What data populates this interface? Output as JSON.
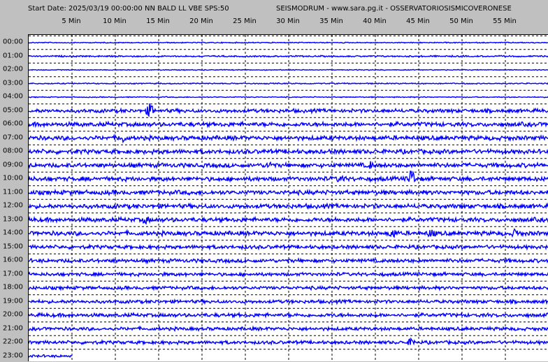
{
  "header": {
    "left": "Start Date: 2025/03/19 00:00:00 NN BALD LL VBE SPS:50",
    "right": "SEISMODRUM - www.sara.pg.it - OSSERVATORIOSISMICOVERONESE"
  },
  "colors": {
    "trace": "#0000ff",
    "background_window": "#c0c0c0",
    "background_plot": "#ffffff",
    "grid": "#000000"
  },
  "chart_data": {
    "type": "line",
    "x_unit": "minutes",
    "xlim": [
      0,
      60
    ],
    "x_ticks": [
      {
        "value": 5,
        "label": "5 Min"
      },
      {
        "value": 10,
        "label": "10 Min"
      },
      {
        "value": 15,
        "label": "15 Min"
      },
      {
        "value": 20,
        "label": "20 Min"
      },
      {
        "value": 25,
        "label": "25 Min"
      },
      {
        "value": 30,
        "label": "30 Min"
      },
      {
        "value": 35,
        "label": "35 Min"
      },
      {
        "value": 40,
        "label": "40 Min"
      },
      {
        "value": 45,
        "label": "45 Min"
      },
      {
        "value": 50,
        "label": "50 Min"
      },
      {
        "value": 55,
        "label": "55 Min"
      }
    ],
    "grid_vertical": true,
    "grid_horizontal": true,
    "rows": [
      {
        "label": "00:00",
        "amp": 0.6,
        "end": 60
      },
      {
        "label": "01:00",
        "amp": 0.9,
        "end": 60
      },
      {
        "label": "02:00",
        "amp": 0.5,
        "end": 60
      },
      {
        "label": "03:00",
        "amp": 0.7,
        "end": 60
      },
      {
        "label": "04:00",
        "amp": 0.6,
        "end": 60
      },
      {
        "label": "05:00",
        "amp": 2.2,
        "end": 60,
        "events": [
          {
            "t": 14.0,
            "a": 9
          }
        ]
      },
      {
        "label": "06:00",
        "amp": 2.6,
        "end": 60
      },
      {
        "label": "07:00",
        "amp": 2.6,
        "end": 60,
        "events": [
          {
            "t": 10.8,
            "a": 5
          }
        ]
      },
      {
        "label": "08:00",
        "amp": 2.6,
        "end": 60
      },
      {
        "label": "09:00",
        "amp": 2.6,
        "end": 60,
        "events": [
          {
            "t": 27.8,
            "a": 4
          },
          {
            "t": 39.5,
            "a": 4
          }
        ]
      },
      {
        "label": "10:00",
        "amp": 2.6,
        "end": 60,
        "events": [
          {
            "t": 44.2,
            "a": 14
          },
          {
            "t": 36.0,
            "a": 4
          }
        ]
      },
      {
        "label": "11:00",
        "amp": 2.6,
        "end": 60
      },
      {
        "label": "12:00",
        "amp": 2.6,
        "end": 60
      },
      {
        "label": "13:00",
        "amp": 2.6,
        "end": 60,
        "events": [
          {
            "t": 13.5,
            "a": 4
          }
        ]
      },
      {
        "label": "14:00",
        "amp": 2.6,
        "end": 60,
        "events": [
          {
            "t": 42.0,
            "a": 6
          },
          {
            "t": 46.5,
            "a": 5
          },
          {
            "t": 56.2,
            "a": 5
          }
        ]
      },
      {
        "label": "15:00",
        "amp": 2.2,
        "end": 60
      },
      {
        "label": "16:00",
        "amp": 2.2,
        "end": 60
      },
      {
        "label": "17:00",
        "amp": 2.0,
        "end": 60
      },
      {
        "label": "18:00",
        "amp": 2.0,
        "end": 60
      },
      {
        "label": "19:00",
        "amp": 2.0,
        "end": 60
      },
      {
        "label": "20:00",
        "amp": 2.2,
        "end": 60
      },
      {
        "label": "21:00",
        "amp": 2.0,
        "end": 60
      },
      {
        "label": "22:00",
        "amp": 2.0,
        "end": 60,
        "events": [
          {
            "t": 44.2,
            "a": 5
          }
        ]
      },
      {
        "label": "23:00",
        "amp": 1.5,
        "end": 5
      }
    ]
  }
}
